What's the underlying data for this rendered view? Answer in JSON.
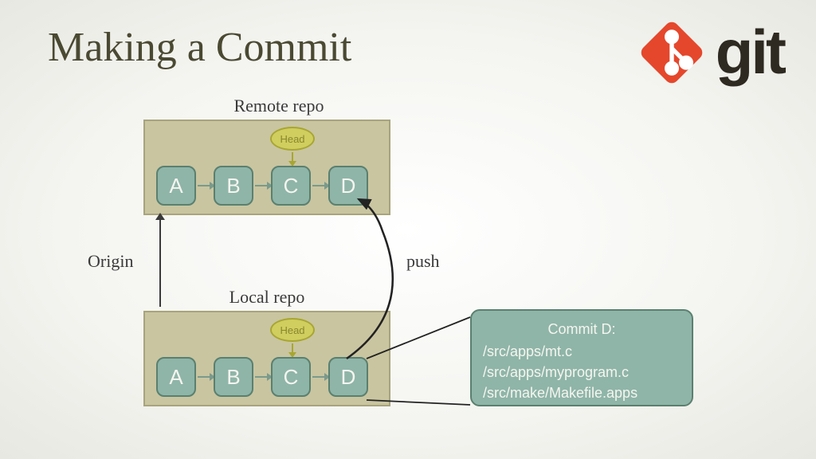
{
  "title": "Making a Commit",
  "logo_text": "git",
  "remote": {
    "label": "Remote repo",
    "head": "Head",
    "commits": [
      "A",
      "B",
      "C",
      "D"
    ]
  },
  "local": {
    "label": "Local repo",
    "head": "Head",
    "commits": [
      "A",
      "B",
      "C",
      "D"
    ]
  },
  "origin_label": "Origin",
  "push_label": "push",
  "commit_detail": {
    "title": "Commit D:",
    "files": [
      "/src/apps/mt.c",
      "/src/apps/myprogram.c",
      "/src/make/Makefile.apps"
    ]
  }
}
